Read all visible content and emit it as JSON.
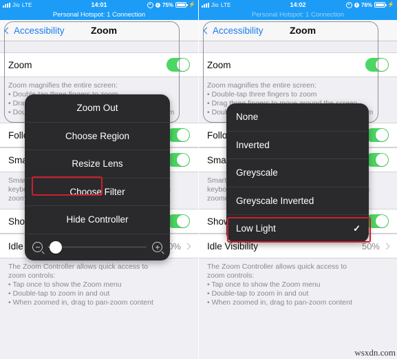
{
  "panels": [
    {
      "status": {
        "carrier": "Jio",
        "network": "LTE",
        "time": "14:01",
        "battery_pct": "75%",
        "signal_icon": "cellular-signal-icon",
        "location_icon": "location-icon",
        "rotation_icon": "rotation-lock-icon",
        "battery_icon": "battery-icon",
        "charging_icon": "lightning-bolt-icon"
      },
      "hotspot_banner": "Personal Hotspot: 1 Connection",
      "nav": {
        "back_label": "Accessibility",
        "title": "Zoom",
        "back_icon": "chevron-left-icon"
      },
      "rows": {
        "zoom_label": "Zoom",
        "zoom_toggle": "on",
        "follow_focus_label": "Follow Focus",
        "smart_typing_label": "Smart Typing",
        "show_controller_label": "Show Controller",
        "idle_visibility_label": "Idle Visibility",
        "idle_visibility_value": "50%"
      },
      "notes": {
        "zoom_note_lines": [
          "Zoom magnifies the entire screen:",
          "• Double-tap three fingers to zoom",
          "• Drag three fingers to move around the screen",
          "• Double-tap three fingers and drag to change zoom"
        ],
        "smart_note_lines": [
          "Smart Typing will switch to Window Zoom when a",
          "keyboard appears. The window will move so text is",
          "zoomed but the keyboard is not."
        ],
        "controller_note_lines": [
          "The Zoom Controller allows quick access to",
          "zoom controls:",
          "• Tap once to show the Zoom menu",
          "• Double-tap to zoom in and out",
          "• When zoomed in, drag to pan-zoom content"
        ]
      },
      "popup": {
        "name": "zoom-menu-popup",
        "items": [
          "Zoom Out",
          "Choose Region",
          "Resize Lens",
          "Choose Filter",
          "Hide Controller"
        ],
        "highlighted_item": "Choose Filter",
        "slider": {
          "minus_icon": "zoom-out-icon",
          "plus_icon": "zoom-in-icon",
          "value_pct": 8
        }
      }
    },
    {
      "status": {
        "carrier": "Jio",
        "network": "LTE",
        "time": "14:02",
        "battery_pct": "76%",
        "signal_icon": "cellular-signal-icon",
        "location_icon": "location-icon",
        "rotation_icon": "rotation-lock-icon",
        "battery_icon": "battery-icon",
        "charging_icon": "lightning-bolt-icon"
      },
      "hotspot_banner": "Personal Hotspot: 1 Connection",
      "nav": {
        "back_label": "Accessibility",
        "title": "Zoom",
        "back_icon": "chevron-left-icon"
      },
      "rows": {
        "zoom_label": "Zoom",
        "zoom_toggle": "on",
        "follow_focus_label": "Follow Focus",
        "smart_typing_label": "Smart Typing",
        "show_controller_label": "Show Controller",
        "idle_visibility_label": "Idle Visibility",
        "idle_visibility_value": "50%"
      },
      "notes": {
        "zoom_note_lines": [
          "Zoom magnifies the entire screen:",
          "• Double-tap three fingers to zoom",
          "• Drag three fingers to move around the screen",
          "• Double-tap three fingers and drag to change zoom"
        ],
        "smart_note_lines": [
          "Smart Typing will switch to Window Zoom when a",
          "keyboard appears. The window will move so text is",
          "zoomed but the keyboard is not."
        ],
        "controller_note_lines": [
          "The Zoom Controller allows quick access to",
          "zoom controls:",
          "• Tap once to show the Zoom menu",
          "• Double-tap to zoom in and out",
          "• When zoomed in, drag to pan-zoom content"
        ]
      },
      "popup": {
        "name": "choose-filter-popup",
        "items": [
          "None",
          "Inverted",
          "Greyscale",
          "Greyscale Inverted",
          "Low Light"
        ],
        "highlighted_item": "Low Light",
        "selected_item": "Low Light",
        "check_glyph": "✓"
      }
    }
  ],
  "watermark": "wsxdn.com",
  "colors": {
    "status_bar": "#1c9cf6",
    "toggle_on": "#4cd763",
    "accent_link": "#1c7ced",
    "highlight_border": "#cc1f2e",
    "popup_bg": "#2a2a2c",
    "page_bg": "#efeff4"
  }
}
